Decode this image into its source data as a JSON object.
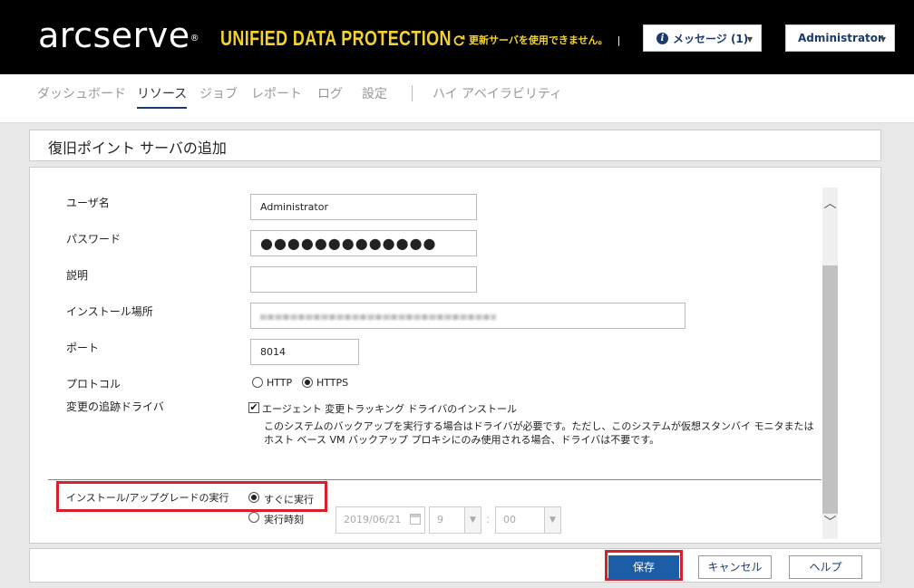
{
  "header": {
    "logo_text": "arcserve",
    "logo_mark": "®",
    "product_name": "UNIFIED DATA PROTECTION",
    "update_warning": "更新サーバを使用できません。",
    "messages_button": "メッセージ (1)",
    "user_button": "Administrator"
  },
  "nav": {
    "items": [
      "ダッシュボード",
      "リソース",
      "ジョブ",
      "レポート",
      "ログ",
      "設定",
      "ハイ アベイラビリティ"
    ],
    "active": "リソース"
  },
  "page_title": "復旧ポイント サーバの追加",
  "form": {
    "username_label": "ユーザ名",
    "username_value": "Administrator",
    "password_label": "パスワード",
    "password_value": "●●●●●●●●●●●●●",
    "description_label": "説明",
    "description_value": "",
    "install_path_label": "インストール場所",
    "port_label": "ポート",
    "port_value": "8014",
    "protocol_label": "プロトコル",
    "protocol_http": "HTTP",
    "protocol_https": "HTTPS",
    "protocol_selected": "HTTPS",
    "driver_label": "変更の追跡ドライバ",
    "driver_checkbox_label": "エージェント 変更トラッキング ドライバのインストール",
    "driver_checked": true,
    "driver_note": "このシステムのバックアップを実行する場合はドライバが必要です。ただし、このシステムが仮想スタンバイ モニタまたはホスト ベース VM バックアップ プロキシにのみ使用される場合、ドライバは不要です。",
    "install_run_label": "インストール/アップグレードの実行",
    "run_now_label": "すぐに実行",
    "run_scheduled_label": "実行時刻",
    "run_selected": "すぐに実行",
    "schedule_date": "2019/06/21",
    "schedule_hour": "9",
    "schedule_minute": "00",
    "time_separator": ":"
  },
  "footer": {
    "save": "保存",
    "cancel": "キャンセル",
    "help": "ヘルプ"
  },
  "colors": {
    "header_bg": "#000000",
    "brand_yellow": "#f2d230",
    "primary_blue": "#1c5da8",
    "highlight_red": "#d8202a"
  }
}
